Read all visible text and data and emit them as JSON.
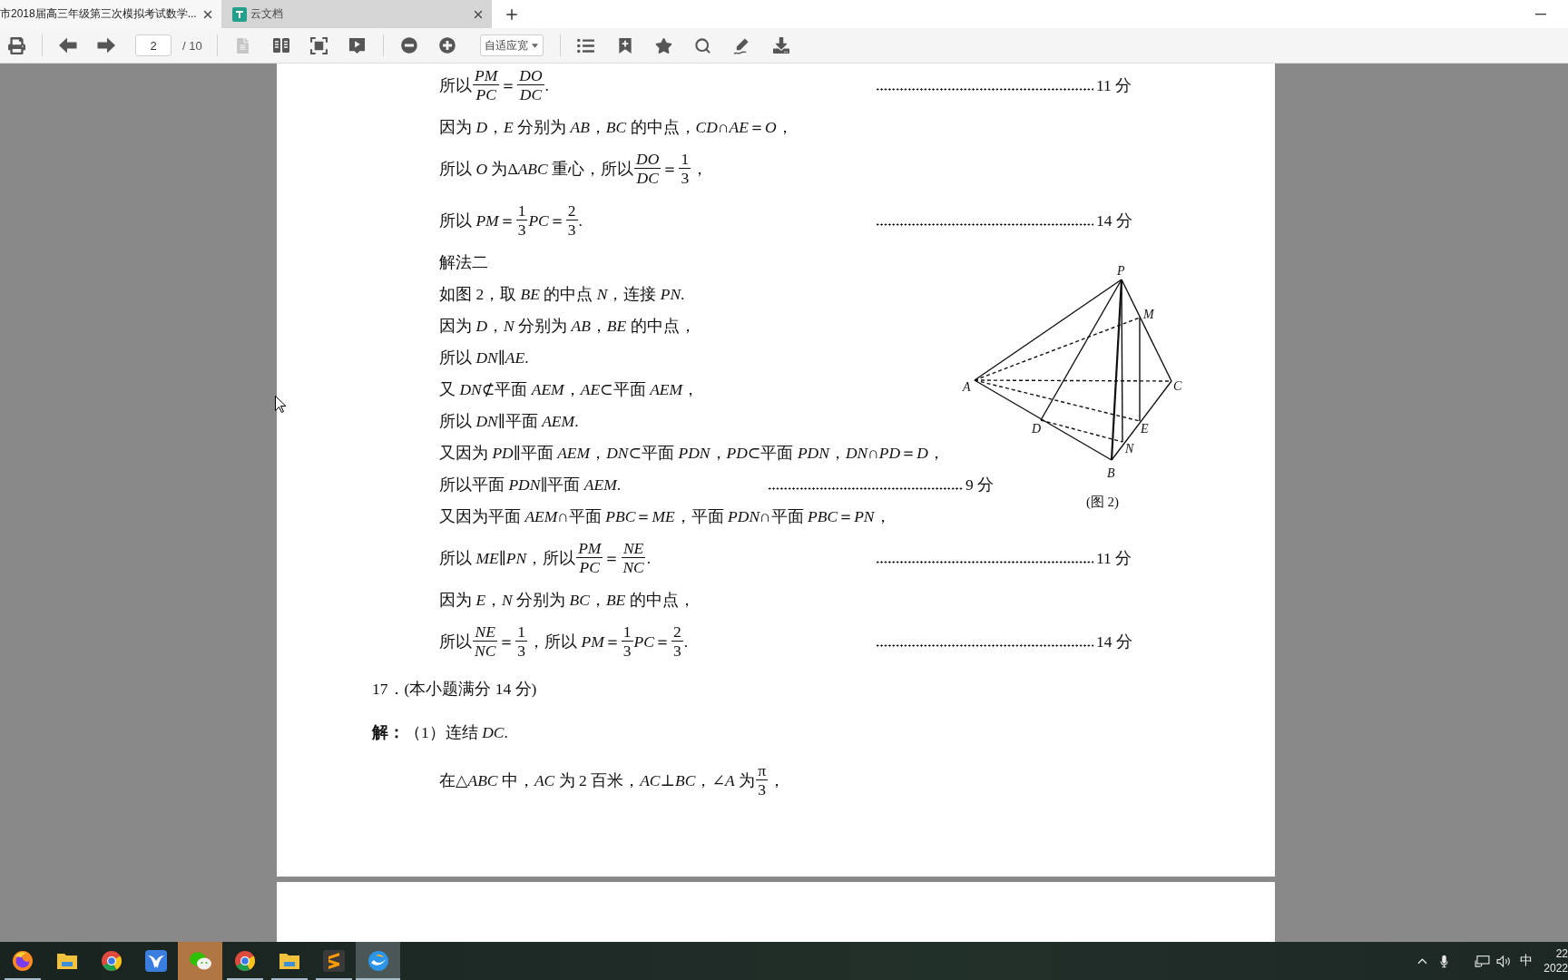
{
  "tabs": [
    {
      "kind": "document",
      "title": "市2018届高三年级第三次模拟考试数学...",
      "selected": true
    },
    {
      "kind": "cloud",
      "title": "云文档",
      "selected": false
    }
  ],
  "toolbar": {
    "groups": [
      [
        {
          "kind": "print",
          "disabled": false
        }
      ],
      [
        {
          "kind": "previous",
          "disabled": false
        },
        {
          "kind": "next",
          "disabled": false
        },
        {
          "kind": "page",
          "value": "2",
          "total": "/ 10"
        }
      ],
      [
        {
          "kind": "single_page",
          "disabled": true
        },
        {
          "kind": "two_page",
          "disabled": false
        },
        {
          "kind": "fit",
          "disabled": false
        },
        {
          "kind": "present",
          "disabled": false
        }
      ],
      [
        {
          "kind": "zoom_out",
          "disabled": false
        },
        {
          "kind": "zoom_in",
          "disabled": false
        },
        {
          "kind": "zoom_select",
          "value": "自适应宽"
        }
      ],
      [
        {
          "kind": "outline",
          "disabled": false
        },
        {
          "kind": "bookmark",
          "disabled": false
        },
        {
          "kind": "favorite",
          "disabled": false
        },
        {
          "kind": "search",
          "disabled": false
        },
        {
          "kind": "annotate",
          "disabled": false
        },
        {
          "kind": "download",
          "disabled": false
        }
      ]
    ]
  },
  "document": {
    "blocks": [
      {
        "kind": "line",
        "parts": [
          {
            "kind": "text",
            "text": "所以"
          },
          {
            "kind": "fraction",
            "numerator": "PM",
            "denominator": "PC",
            "italic": true
          },
          {
            "kind": "text",
            "text": "＝"
          },
          {
            "kind": "fraction",
            "numerator": "DO",
            "denominator": "DC",
            "italic": true
          },
          {
            "kind": "text",
            "text": "."
          }
        ],
        "score": "11 分"
      },
      {
        "kind": "line",
        "parts": [
          {
            "kind": "text",
            "text": "因为 *D*，*E* 分别为 *AB*，*BC* 的中点，*CD*∩*AE*＝*O*，"
          }
        ]
      },
      {
        "kind": "line",
        "parts": [
          {
            "kind": "text",
            "text": "所以 *O* 为Δ"
          },
          {
            "kind": "text",
            "text": "*ABC* 重心，所以"
          },
          {
            "kind": "fraction",
            "numerator": "DO",
            "denominator": "DC",
            "italic": true
          },
          {
            "kind": "text",
            "text": "＝"
          },
          {
            "kind": "fraction",
            "numerator": "1",
            "denominator": "3",
            "italic": false
          },
          {
            "kind": "text",
            "text": "，"
          }
        ]
      },
      {
        "kind": "line",
        "parts": [
          {
            "kind": "text",
            "text": "所以 *PM*＝"
          },
          {
            "kind": "fraction",
            "numerator": "1",
            "denominator": "3",
            "italic": false
          },
          {
            "kind": "text",
            "text": "*PC*＝"
          },
          {
            "kind": "fraction",
            "numerator": "2",
            "denominator": "3",
            "italic": false
          },
          {
            "kind": "text",
            "text": "."
          }
        ],
        "score": "14 分"
      },
      {
        "kind": "figure_block",
        "lines": [
          {
            "kind": "line",
            "parts": [
              {
                "kind": "text",
                "text": "解法二"
              }
            ]
          },
          {
            "kind": "line",
            "parts": [
              {
                "kind": "text",
                "text": "如图 2，取 *BE* 的中点 *N*，连接 *PN*."
              }
            ]
          },
          {
            "kind": "line",
            "parts": [
              {
                "kind": "text",
                "text": "因为 *D*，*N* 分别为 *AB*，*BE* 的中点，"
              }
            ]
          },
          {
            "kind": "line",
            "parts": [
              {
                "kind": "text",
                "text": "所以 *DN*∥*AE*."
              }
            ]
          },
          {
            "kind": "line",
            "parts": [
              {
                "kind": "text",
                "text": "又 *DN*⊄平面 *AEM*，*AE*⊂平面 *AEM*，"
              }
            ]
          },
          {
            "kind": "line",
            "parts": [
              {
                "kind": "text",
                "text": "所以 *DN*∥平面 *AEM*."
              }
            ]
          },
          {
            "kind": "line",
            "parts": [
              {
                "kind": "text",
                "text": "又因为 *PD*∥平面 *AEM*，*DN*⊂平面 *PDN*，*PD*⊂平面 *PDN*，*DN*∩*PD*＝*D*，"
              }
            ]
          },
          {
            "kind": "line",
            "parts": [
              {
                "kind": "text",
                "text": "所以平面 *PDN*∥平面 *AEM*."
              }
            ],
            "score": "9 分"
          },
          {
            "kind": "line",
            "parts": [
              {
                "kind": "text",
                "text": "又因为平面 *AEM*∩平面 *PBC*＝*ME*，平面 *PDN*∩平面 *PBC*＝*PN*，"
              }
            ]
          }
        ],
        "figure": {
          "labels": [
            "P",
            "M",
            "A",
            "C",
            "D",
            "E",
            "N",
            "B"
          ],
          "caption": "(图 2)"
        }
      },
      {
        "kind": "line",
        "parts": [
          {
            "kind": "text",
            "text": "所以 *ME*∥*PN*，所以"
          },
          {
            "kind": "fraction",
            "numerator": "PM",
            "denominator": "PC",
            "italic": true
          },
          {
            "kind": "text",
            "text": "＝"
          },
          {
            "kind": "fraction",
            "numerator": "NE",
            "denominator": "NC",
            "italic": true
          },
          {
            "kind": "text",
            "text": "."
          }
        ],
        "score": "11 分"
      },
      {
        "kind": "line",
        "parts": [
          {
            "kind": "text",
            "text": "因为 *E*，*N* 分别为 *BC*，*BE* 的中点，"
          }
        ]
      },
      {
        "kind": "line",
        "parts": [
          {
            "kind": "text",
            "text": "所以"
          },
          {
            "kind": "fraction",
            "numerator": "NE",
            "denominator": "NC",
            "italic": true
          },
          {
            "kind": "text",
            "text": "＝"
          },
          {
            "kind": "fraction",
            "numerator": "1",
            "denominator": "3",
            "italic": false
          },
          {
            "kind": "text",
            "text": "，所以 *PM*＝"
          },
          {
            "kind": "fraction",
            "numerator": "1",
            "denominator": "3",
            "italic": false
          },
          {
            "kind": "text",
            "text": "*PC*＝"
          },
          {
            "kind": "fraction",
            "numerator": "2",
            "denominator": "3",
            "italic": false
          },
          {
            "kind": "text",
            "text": "."
          }
        ],
        "score": "14 分"
      },
      {
        "kind": "heading",
        "parts": [
          {
            "kind": "text",
            "text": "17．(本小题满分 14 分)"
          }
        ]
      },
      {
        "kind": "heading",
        "parts": [
          {
            "kind": "text",
            "text": "**解：**（1）连结 *DC*."
          }
        ]
      },
      {
        "kind": "line",
        "parts": [
          {
            "kind": "text",
            "text": "在△*ABC* 中，*AC* 为 2 百米，*AC*⊥*BC*，∠*A* 为"
          },
          {
            "kind": "fraction",
            "numerator": "π",
            "denominator": "3",
            "italic": false
          },
          {
            "kind": "text",
            "text": "，"
          }
        ]
      }
    ]
  },
  "taskbar": {
    "apps": [
      {
        "kind": "swirl_browser",
        "selected": false,
        "attention": false,
        "running": true
      },
      {
        "kind": "folder",
        "selected": false,
        "attention": false,
        "running": false
      },
      {
        "kind": "ring_browser",
        "selected": false,
        "attention": false,
        "running": false
      },
      {
        "kind": "bird",
        "selected": false,
        "attention": false,
        "running": false
      },
      {
        "kind": "chat",
        "selected": false,
        "attention": true,
        "running": false
      },
      {
        "kind": "ring_browser",
        "selected": false,
        "attention": false,
        "running": true
      },
      {
        "kind": "folder",
        "selected": false,
        "attention": false,
        "running": true
      },
      {
        "kind": "stripes",
        "selected": false,
        "attention": false,
        "running": true
      },
      {
        "kind": "swoosh",
        "selected": true,
        "attention": false,
        "running": false
      }
    ],
    "tray": {
      "ime": "中",
      "time": "22",
      "date": "2022"
    }
  }
}
